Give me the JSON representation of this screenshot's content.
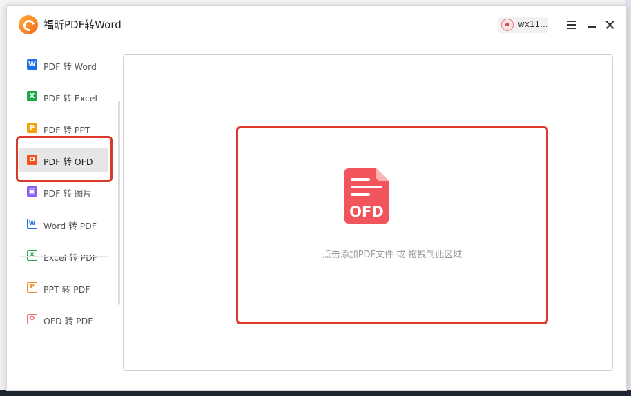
{
  "app": {
    "title": "福昕PDF转Word",
    "user_name": "wx11..."
  },
  "sidebar": {
    "items": [
      {
        "label": "PDF 转 Word",
        "icon": "word-icon",
        "glyph": "W",
        "color": "#1e6fe6",
        "outline": false
      },
      {
        "label": "PDF 转 Excel",
        "icon": "excel-icon",
        "glyph": "X",
        "color": "#1fa84a",
        "outline": false
      },
      {
        "label": "PDF 转 PPT",
        "icon": "ppt-icon",
        "glyph": "P",
        "color": "#f5a10c",
        "outline": false
      },
      {
        "label": "PDF 转 OFD",
        "icon": "ofd-icon",
        "glyph": "O",
        "color": "#f0531c",
        "outline": false,
        "active": true
      },
      {
        "label": "PDF 转 图片",
        "icon": "image-icon",
        "glyph": "▣",
        "color": "#8b5cf6",
        "outline": false
      },
      {
        "label": "Word 转 PDF",
        "icon": "word-outline-icon",
        "glyph": "W",
        "color": "#1e6fe6",
        "outline": true
      },
      {
        "label": "Excel 转 PDF",
        "icon": "excel-outline-icon",
        "glyph": "X",
        "color": "#1fa84a",
        "outline": true
      },
      {
        "label": "PPT 转 PDF",
        "icon": "ppt-outline-icon",
        "glyph": "P",
        "color": "#f08a24",
        "outline": true
      },
      {
        "label": "OFD 转 PDF",
        "icon": "ofd-outline-icon",
        "glyph": "O",
        "color": "#f0737a",
        "outline": true
      }
    ]
  },
  "drop_zone": {
    "icon_text": "OFD",
    "hint": "点击添加PDF文件 或 拖拽到此区域"
  },
  "colors": {
    "highlight": "#d9392b",
    "ofd_icon": "#f2545b"
  }
}
